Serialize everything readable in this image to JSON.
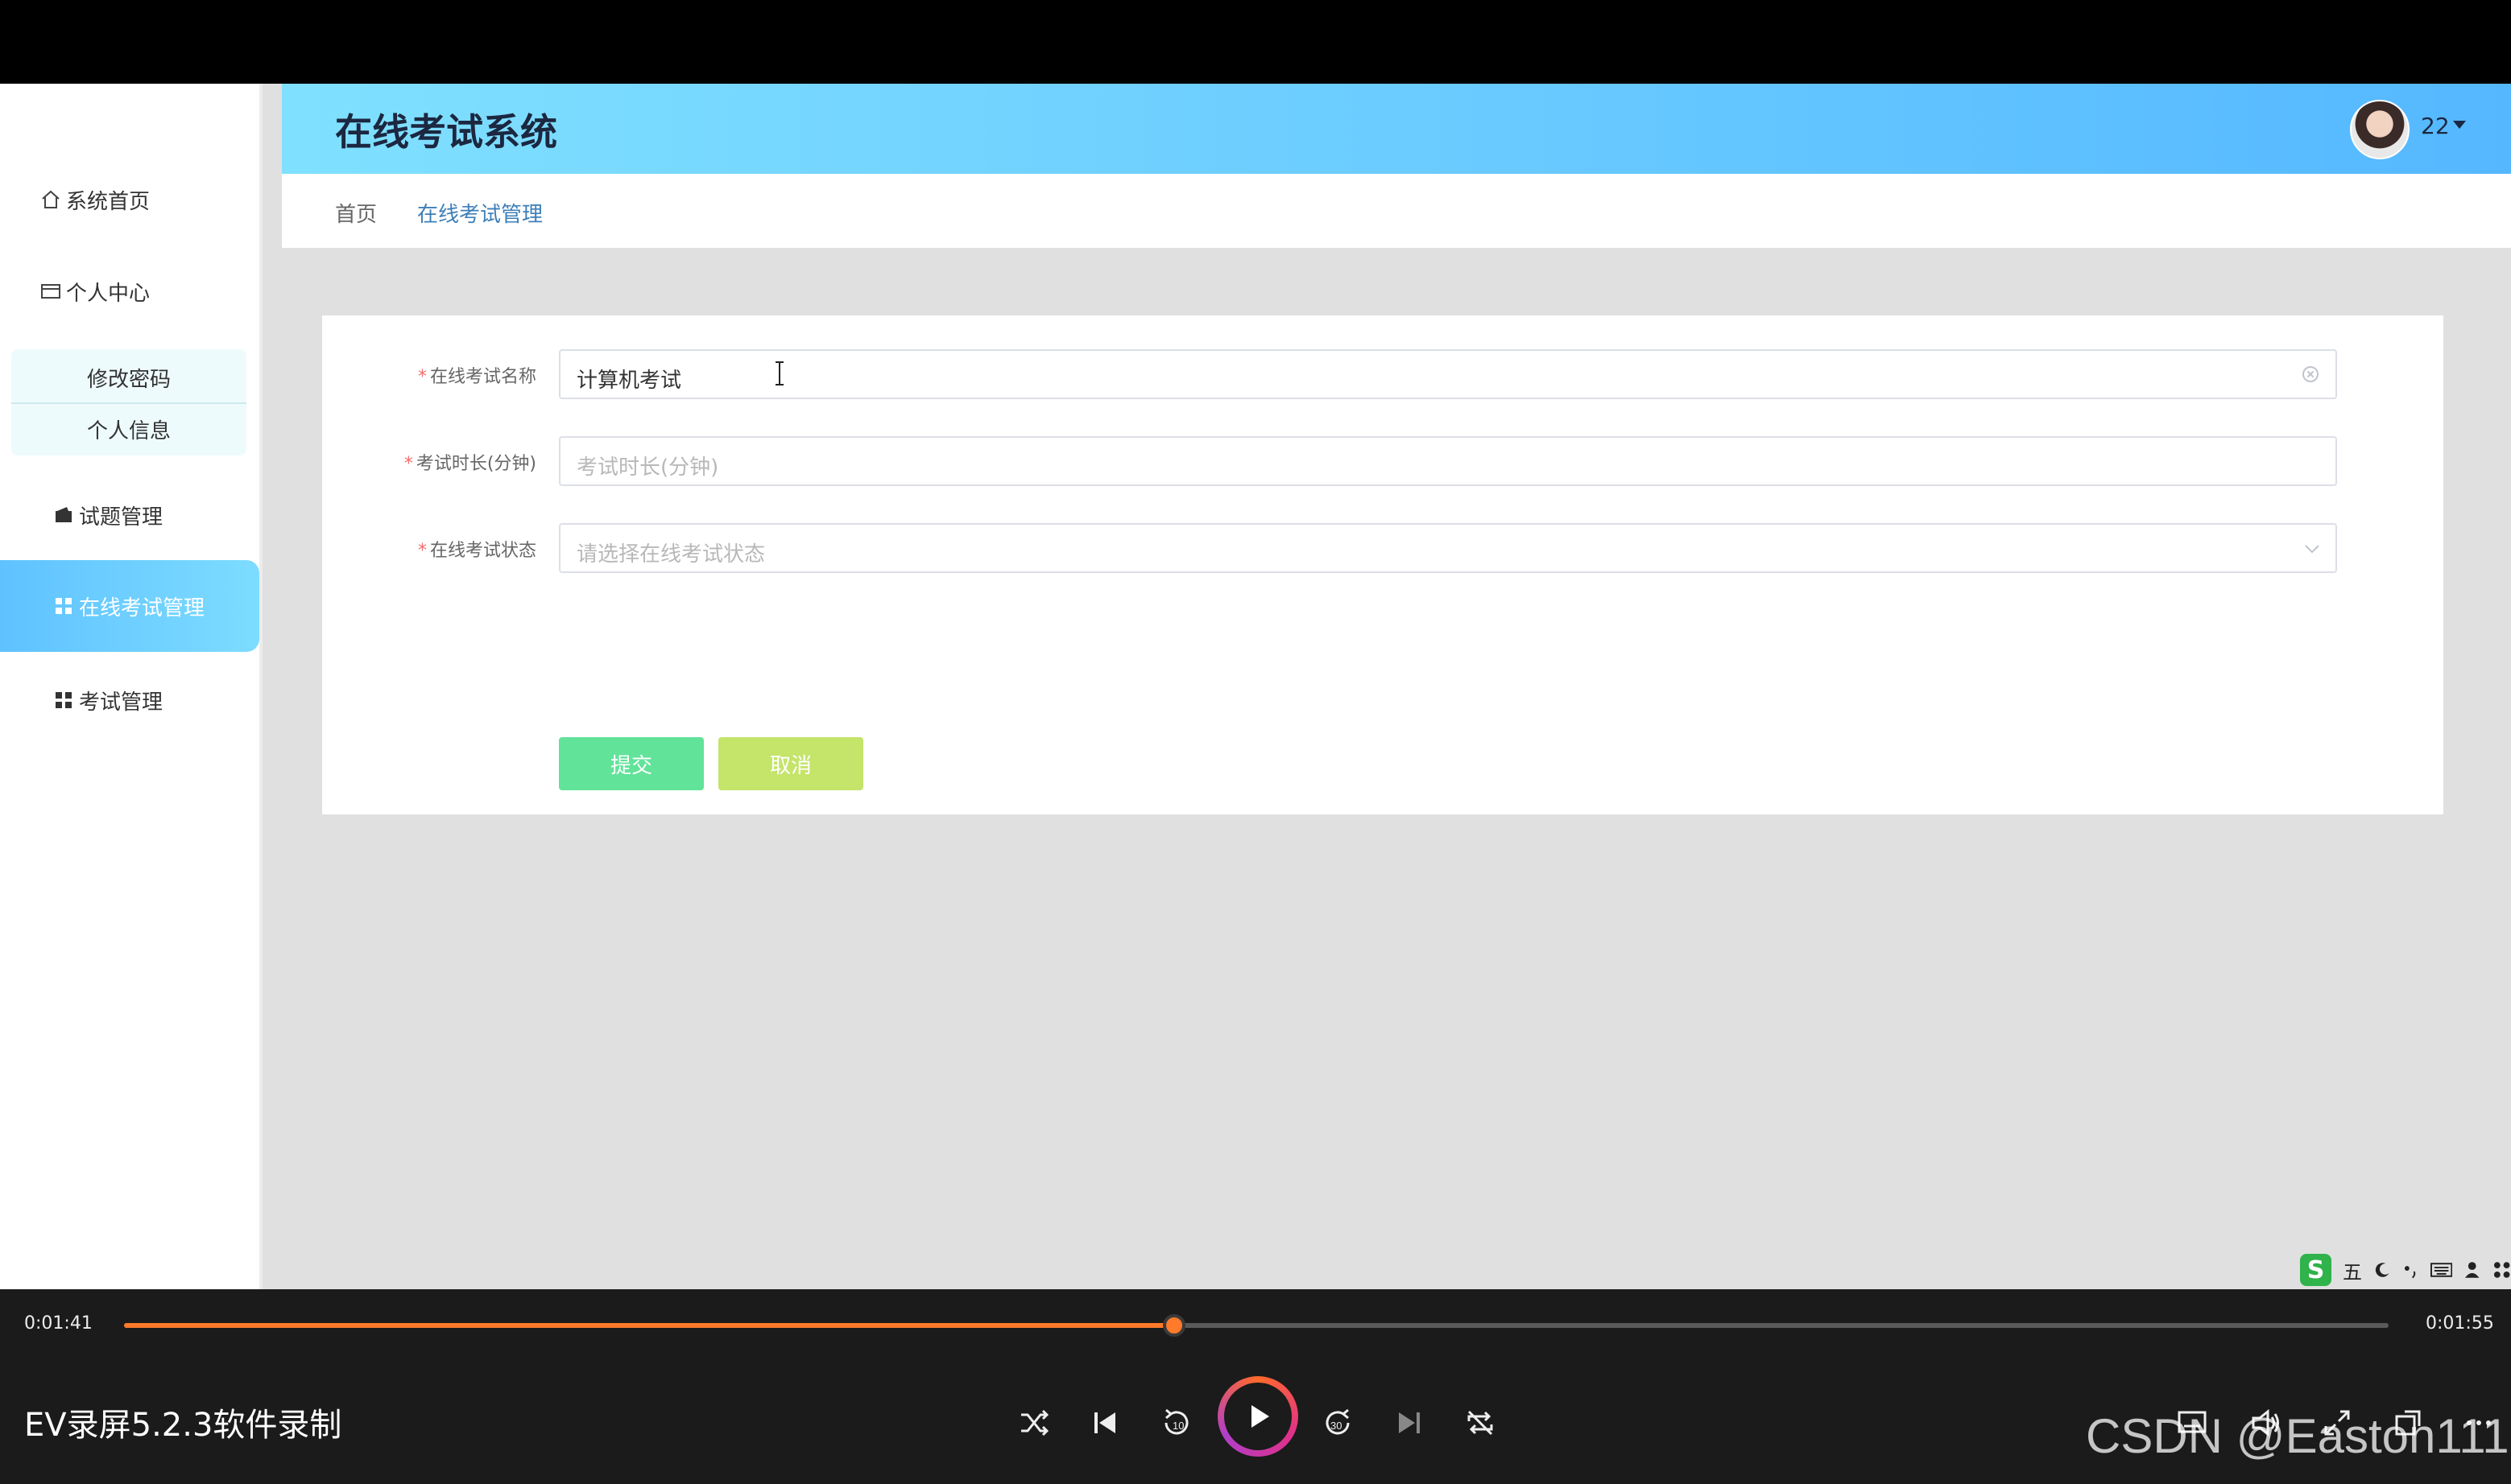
{
  "app": {
    "title": "在线考试系统",
    "user": {
      "name": "22"
    }
  },
  "sidebar": {
    "items": [
      {
        "label": "系统首页",
        "icon": "home-icon"
      },
      {
        "label": "个人中心",
        "icon": "id-card-icon"
      },
      {
        "label": "试题管理",
        "icon": "wallet-icon"
      },
      {
        "label": "在线考试管理",
        "icon": "grid-icon",
        "active": true
      },
      {
        "label": "考试管理",
        "icon": "grid-icon"
      }
    ],
    "submenu": [
      {
        "label": "修改密码"
      },
      {
        "label": "个人信息"
      }
    ],
    "active_color": "#5fc2ff"
  },
  "breadcrumb": {
    "home": "首页",
    "current": "在线考试管理"
  },
  "form": {
    "fields": [
      {
        "label": "在线考试名称",
        "required": "*",
        "value": "计算机考试"
      },
      {
        "label": "考试时长(分钟)",
        "required": "*",
        "placeholder": "考试时长(分钟)"
      },
      {
        "label": "在线考试状态",
        "required": "*",
        "placeholder": "请选择在线考试状态"
      }
    ],
    "submit_label": "提交",
    "cancel_label": "取消"
  },
  "ime": {
    "mode": "五",
    "logo": "S"
  },
  "player": {
    "current_time": "0:01:41",
    "total_time": "0:01:55",
    "progress": 0.4639,
    "title": "EV录屏5.2.3软件录制",
    "watermark": "CSDN @Easton111",
    "accent": "#ff7a2a"
  }
}
